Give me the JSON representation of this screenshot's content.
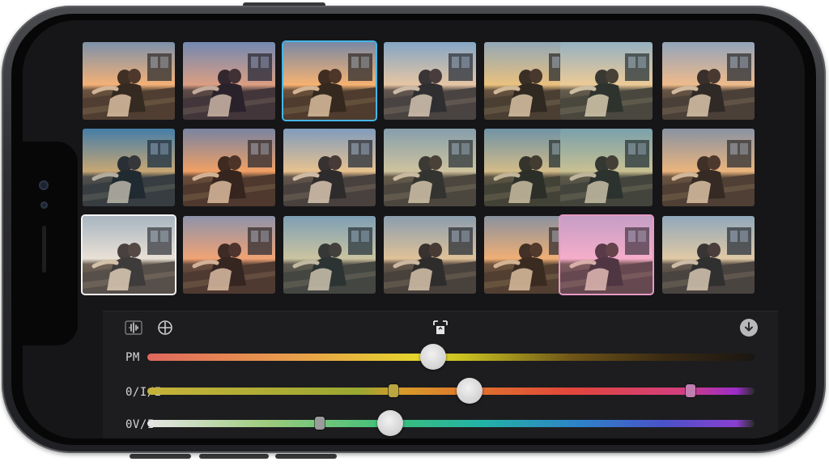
{
  "sliders": [
    {
      "label": "PM",
      "value": 0.47
    },
    {
      "label": "0/I/I",
      "value": 0.53
    },
    {
      "label": "0V/I",
      "value": 0.4
    }
  ],
  "toolbar": {
    "left_icons": [
      "waveform-icon",
      "crosshair-icon"
    ],
    "center_icon": "crop-icon",
    "right_icon": "download-icon"
  },
  "colors": {
    "accent_selected": "#45b4e8",
    "highlight_white": "#f2f2f2",
    "highlight_pink": "#e59ac4",
    "panel_bg": "#1d1d1f"
  }
}
